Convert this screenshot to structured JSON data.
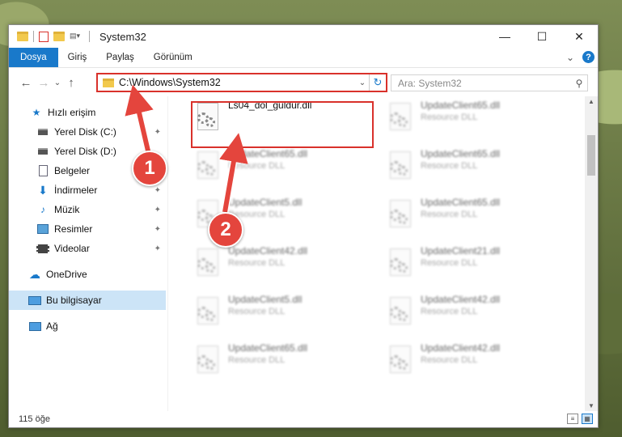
{
  "window": {
    "title": "System32",
    "minimize_glyph": "—",
    "maximize_glyph": "☐",
    "close_glyph": "✕"
  },
  "ribbon": {
    "tabs": [
      "Dosya",
      "Giriş",
      "Paylaş",
      "Görünüm"
    ],
    "help_glyph": "?",
    "collapse_glyph": "⌄"
  },
  "nav": {
    "back_glyph": "←",
    "forward_glyph": "→",
    "recent_glyph": "⌄",
    "up_glyph": "↑",
    "address": "C:\\Windows\\System32",
    "address_dropdown_glyph": "⌄",
    "refresh_glyph": "↻",
    "search_placeholder": "Ara: System32",
    "search_glyph": "⚲"
  },
  "sidebar": {
    "items": [
      {
        "label": "Hızlı erişim",
        "icon": "star-icon"
      },
      {
        "label": "Yerel Disk (C:)",
        "icon": "drive-icon"
      },
      {
        "label": "Yerel Disk (D:)",
        "icon": "drive-icon"
      },
      {
        "label": "Belgeler",
        "icon": "document-icon"
      },
      {
        "label": "İndirmeler",
        "icon": "download-icon"
      },
      {
        "label": "Müzik",
        "icon": "music-icon"
      },
      {
        "label": "Resimler",
        "icon": "pictures-icon"
      },
      {
        "label": "Videolar",
        "icon": "video-icon"
      },
      {
        "label": "OneDrive",
        "icon": "cloud-icon"
      },
      {
        "label": "Bu bilgisayar",
        "icon": "computer-icon"
      },
      {
        "label": "Ağ",
        "icon": "network-icon"
      }
    ],
    "pin_glyph": "📌"
  },
  "files": {
    "main": {
      "name": "Ls04_dol_guldur.dll",
      "desc": ""
    },
    "blurred": [
      {
        "name": "UpdateClient65.dll",
        "desc": "Resource DLL"
      },
      {
        "name": "UpdateClient65.dll",
        "desc": "Resource DLL"
      },
      {
        "name": "UpdateClient65.dll",
        "desc": "Resource DLL"
      },
      {
        "name": "UpdateClient5.dll",
        "desc": "Resource DLL"
      },
      {
        "name": "UpdateClient65.dll",
        "desc": "Resource DLL"
      },
      {
        "name": "UpdateClient42.dll",
        "desc": "Resource DLL"
      },
      {
        "name": "UpdateClient21.dll",
        "desc": "Resource DLL"
      },
      {
        "name": "UpdateClient5.dll",
        "desc": "Resource DLL"
      },
      {
        "name": "UpdateClient42.dll",
        "desc": "Resource DLL"
      },
      {
        "name": "UpdateClient65.dll",
        "desc": "Resource DLL"
      },
      {
        "name": "UpdateClient42.dll",
        "desc": "Resource DLL"
      }
    ]
  },
  "status": {
    "count": "115 öğe"
  },
  "callouts": [
    "1",
    "2"
  ],
  "colors": {
    "accent": "#1979ca",
    "highlight": "#d9312b",
    "callout": "#e4453d"
  }
}
